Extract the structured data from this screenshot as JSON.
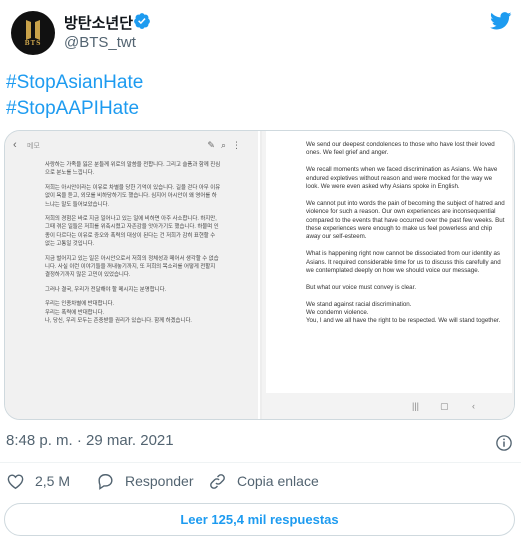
{
  "author": {
    "display_name": "방탄소년단",
    "handle": "@BTS_twt",
    "avatar_text": "BTS",
    "verified": true
  },
  "tweet": {
    "hashtags": [
      "#StopAsianHate",
      "#StopAAPIHate"
    ],
    "timestamp": "8:48 p. m. · 29 mar. 2021"
  },
  "media": {
    "left_image": {
      "header_title": "메모",
      "paragraphs": [
        "사랑하는 가족을 잃은 분들께 위로의 말씀을 전합니다. 그리고 슬픔과 함께 진심으로 분노를 느낍니다.",
        "저희는 아시안이라는 이유로 차별을 당한 기억이 있습니다. 길을 걷다 아무 이유 없이 욕을 듣고, 외모를 비하당하기도 했습니다. 심지어 아시안이 왜 영어를 하느냐는 말도 들어보았습니다.",
        "저희의 경험은 바로 지금 일어나고 있는 일에 비하면 아주 사소합니다. 하지만, 그때 겪은 일들은 저희를 위축시켰고 자존감을 앗아가기도 했습니다. 하물며 인종이 다르다는 이유로 증오와 폭력의 대상이 된다는 건 저희가 감히 표현할 수 없는 고통일 것입니다.",
        "지금 벌어지고 있는 일은 아시안으로서 저희의 정체성과 떼어서 생각할 수 없습니다. 사실 이런 이야기들을 꺼내놓기까지, 또 저희의 목소리를 어떻게 전할지 결정하기까지 많은 고민이 있었습니다.",
        "그러나 결국, 우리가 전달해야 할 메시지는 분명합니다.",
        "우리는 인종차별에 반대합니다.\n우리는 폭력에 반대합니다.\n나, 당신, 우리 모두는 존중받을 권리가 있습니다. 함께 하겠습니다."
      ]
    },
    "right_image": {
      "paragraphs": [
        "We send our deepest condolences to those who have lost their loved ones. We feel grief and anger.",
        "We recall moments when we faced discrimination as Asians. We have endured expletives without reason and were mocked for the way we look. We were even asked why Asians spoke in English.",
        "We cannot put into words the pain of becoming the subject of hatred and violence for such a reason. Our own experiences are inconsequential compared to the events that have occurred over the past few weeks. But these experiences were enough to make us feel powerless and chip away our self-esteem.",
        "What is happening right now cannot be dissociated from our identity as Asians. It required considerable time for us to discuss this carefully and we contemplated deeply on how we should voice our message.",
        "But what our voice must convey is clear.",
        "We stand against racial discrimination.\nWe condemn violence.\nYou, I and we all have the right to be respected. We will stand together."
      ]
    }
  },
  "actions": {
    "like_count": "2,5 M",
    "reply_label": "Responder",
    "copy_label": "Copia enlace"
  },
  "read_replies_label": "Leer 125,4 mil respuestas",
  "colors": {
    "accent": "#1d9bf0",
    "text_primary": "#0f1419",
    "text_secondary": "#536471",
    "border": "#cfd9de"
  },
  "icons": [
    "verified-badge-icon",
    "twitter-bird-icon",
    "info-icon",
    "heart-icon",
    "reply-bubble-icon",
    "link-icon"
  ]
}
